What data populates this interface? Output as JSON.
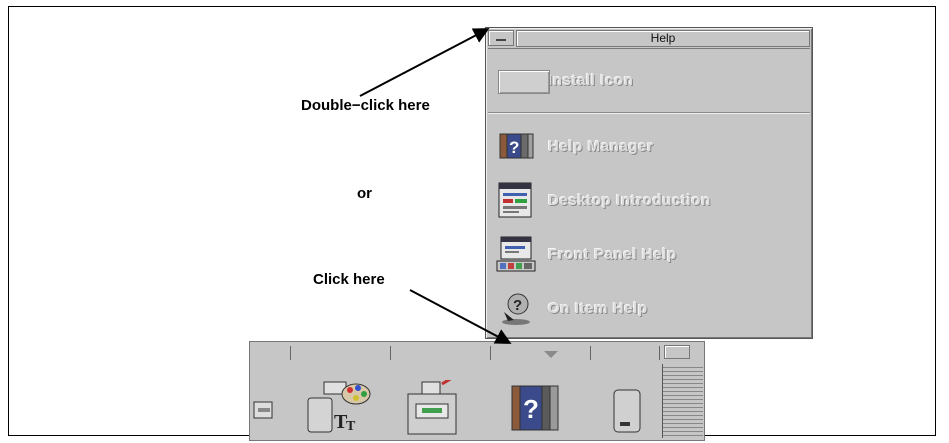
{
  "subpanel": {
    "title": "Help",
    "items": [
      {
        "label": "Install Icon",
        "icon": "install-icon"
      },
      {
        "label": "Help Manager",
        "icon": "help-manager-icon"
      },
      {
        "label": "Desktop Introduction",
        "icon": "desktop-introduction-icon"
      },
      {
        "label": "Front Panel Help",
        "icon": "front-panel-help-icon"
      },
      {
        "label": "On Item Help",
        "icon": "on-item-help-icon"
      }
    ]
  },
  "annotations": {
    "double_click": "Double−click here",
    "or": "or",
    "click_here": "Click here"
  },
  "front_panel": {
    "icons": [
      "printer-icon",
      "style-manager-icon",
      "file-cabinet-icon",
      "help-books-icon",
      "trash-icon"
    ]
  },
  "colors": {
    "panel_gray": "#c6c6c6",
    "etched_text": "#dcdcdc"
  }
}
